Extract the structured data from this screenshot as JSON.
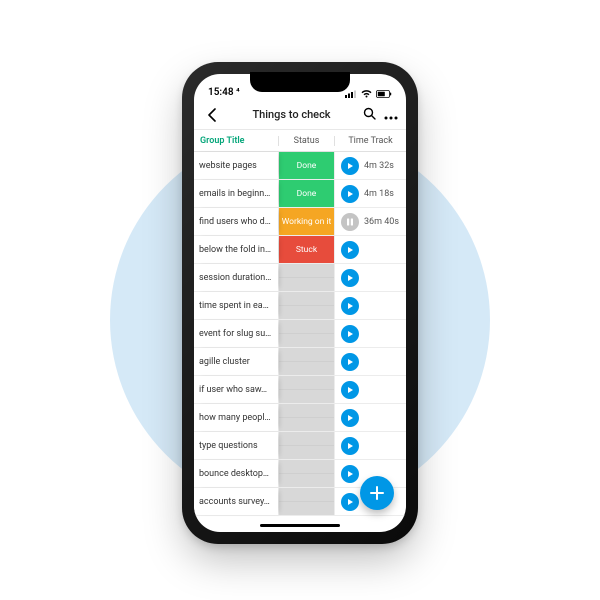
{
  "status_bar": {
    "time": "15:48 ⁴"
  },
  "nav": {
    "title": "Things to check"
  },
  "columns": {
    "group": "Group Title",
    "status": "Status",
    "time": "Time Track"
  },
  "status_colors": {
    "done": "#2ecc71",
    "working": "#f5a623",
    "stuck": "#e74c3c",
    "empty": "striped"
  },
  "rows": [
    {
      "title": "website pages",
      "status_label": "Done",
      "status_key": "done",
      "icon": "play",
      "time": "4m 32s"
    },
    {
      "title": "emails in beginn…",
      "status_label": "Done",
      "status_key": "done",
      "icon": "play",
      "time": "4m 18s"
    },
    {
      "title": "find users who d…",
      "status_label": "Working on it",
      "status_key": "working",
      "icon": "pause",
      "time": "36m 40s"
    },
    {
      "title": "below the fold in…",
      "status_label": "Stuck",
      "status_key": "stuck",
      "icon": "play",
      "time": ""
    },
    {
      "title": "session duration…",
      "status_label": "",
      "status_key": "empty",
      "icon": "play",
      "time": ""
    },
    {
      "title": "time spent in ea…",
      "status_label": "",
      "status_key": "empty",
      "icon": "play",
      "time": ""
    },
    {
      "title": "event for slug su…",
      "status_label": "",
      "status_key": "empty",
      "icon": "play",
      "time": ""
    },
    {
      "title": "agille cluster",
      "status_label": "",
      "status_key": "empty",
      "icon": "play",
      "time": ""
    },
    {
      "title": "if user who saw…",
      "status_label": "",
      "status_key": "empty",
      "icon": "play",
      "time": ""
    },
    {
      "title": "how many peopl…",
      "status_label": "",
      "status_key": "empty",
      "icon": "play",
      "time": ""
    },
    {
      "title": "type questions",
      "status_label": "",
      "status_key": "empty",
      "icon": "play",
      "time": ""
    },
    {
      "title": "bounce desktop…",
      "status_label": "",
      "status_key": "empty",
      "icon": "play",
      "time": ""
    },
    {
      "title": "accounts survey…",
      "status_label": "",
      "status_key": "empty",
      "icon": "play",
      "time": ""
    }
  ]
}
